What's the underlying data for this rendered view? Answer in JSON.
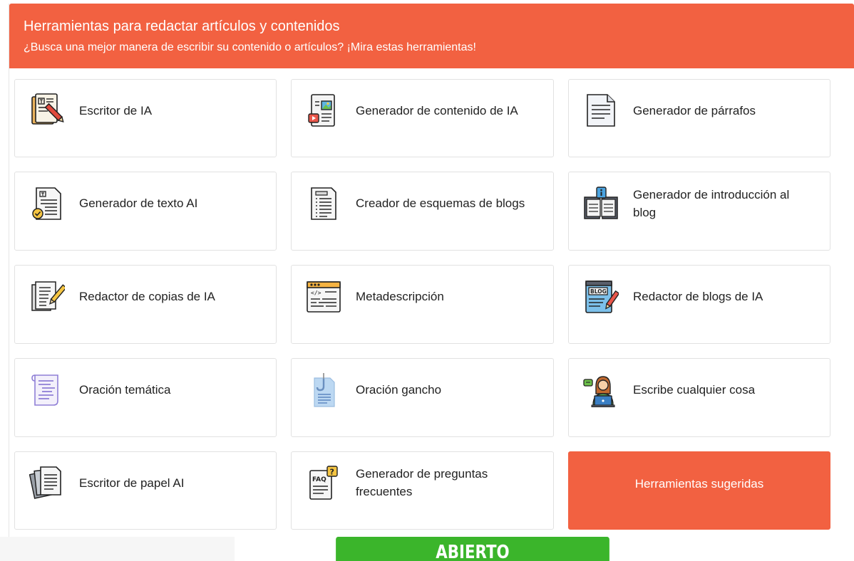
{
  "header": {
    "title": "Herramientas para redactar artículos y contenidos",
    "subtitle": "¿Busca una mejor manera de escribir su contenido o artículos? ¡Mira estas herramientas!"
  },
  "tools": [
    {
      "label": "Escritor de IA",
      "icon": "ai-writer-icon"
    },
    {
      "label": "Generador de contenido de IA",
      "icon": "content-generator-icon"
    },
    {
      "label": "Generador de párrafos",
      "icon": "paragraph-document-icon"
    },
    {
      "label": "Generador de texto AI",
      "icon": "text-document-check-icon"
    },
    {
      "label": "Creador de esquemas de blogs",
      "icon": "outline-document-icon"
    },
    {
      "label": "Generador de introducción al blog",
      "icon": "book-info-icon"
    },
    {
      "label": "Redactor de copias de IA",
      "icon": "copy-writer-icon"
    },
    {
      "label": "Metadescripción",
      "icon": "code-window-icon"
    },
    {
      "label": "Redactor de blogs de IA",
      "icon": "blog-writer-icon"
    },
    {
      "label": "Oración temática",
      "icon": "scroll-document-icon"
    },
    {
      "label": "Oración gancho",
      "icon": "hook-document-icon"
    },
    {
      "label": "Escribe cualquier cosa",
      "icon": "person-laptop-icon"
    },
    {
      "label": "Escritor de papel AI",
      "icon": "paper-stack-icon"
    },
    {
      "label": "Generador de preguntas frecuentes",
      "icon": "faq-document-icon"
    }
  ],
  "suggested": {
    "label": "Herramientas sugeridas"
  },
  "open_button": {
    "label": "ABIERTO"
  },
  "colors": {
    "accent": "#f26141",
    "open_green": "#3bb52b"
  }
}
